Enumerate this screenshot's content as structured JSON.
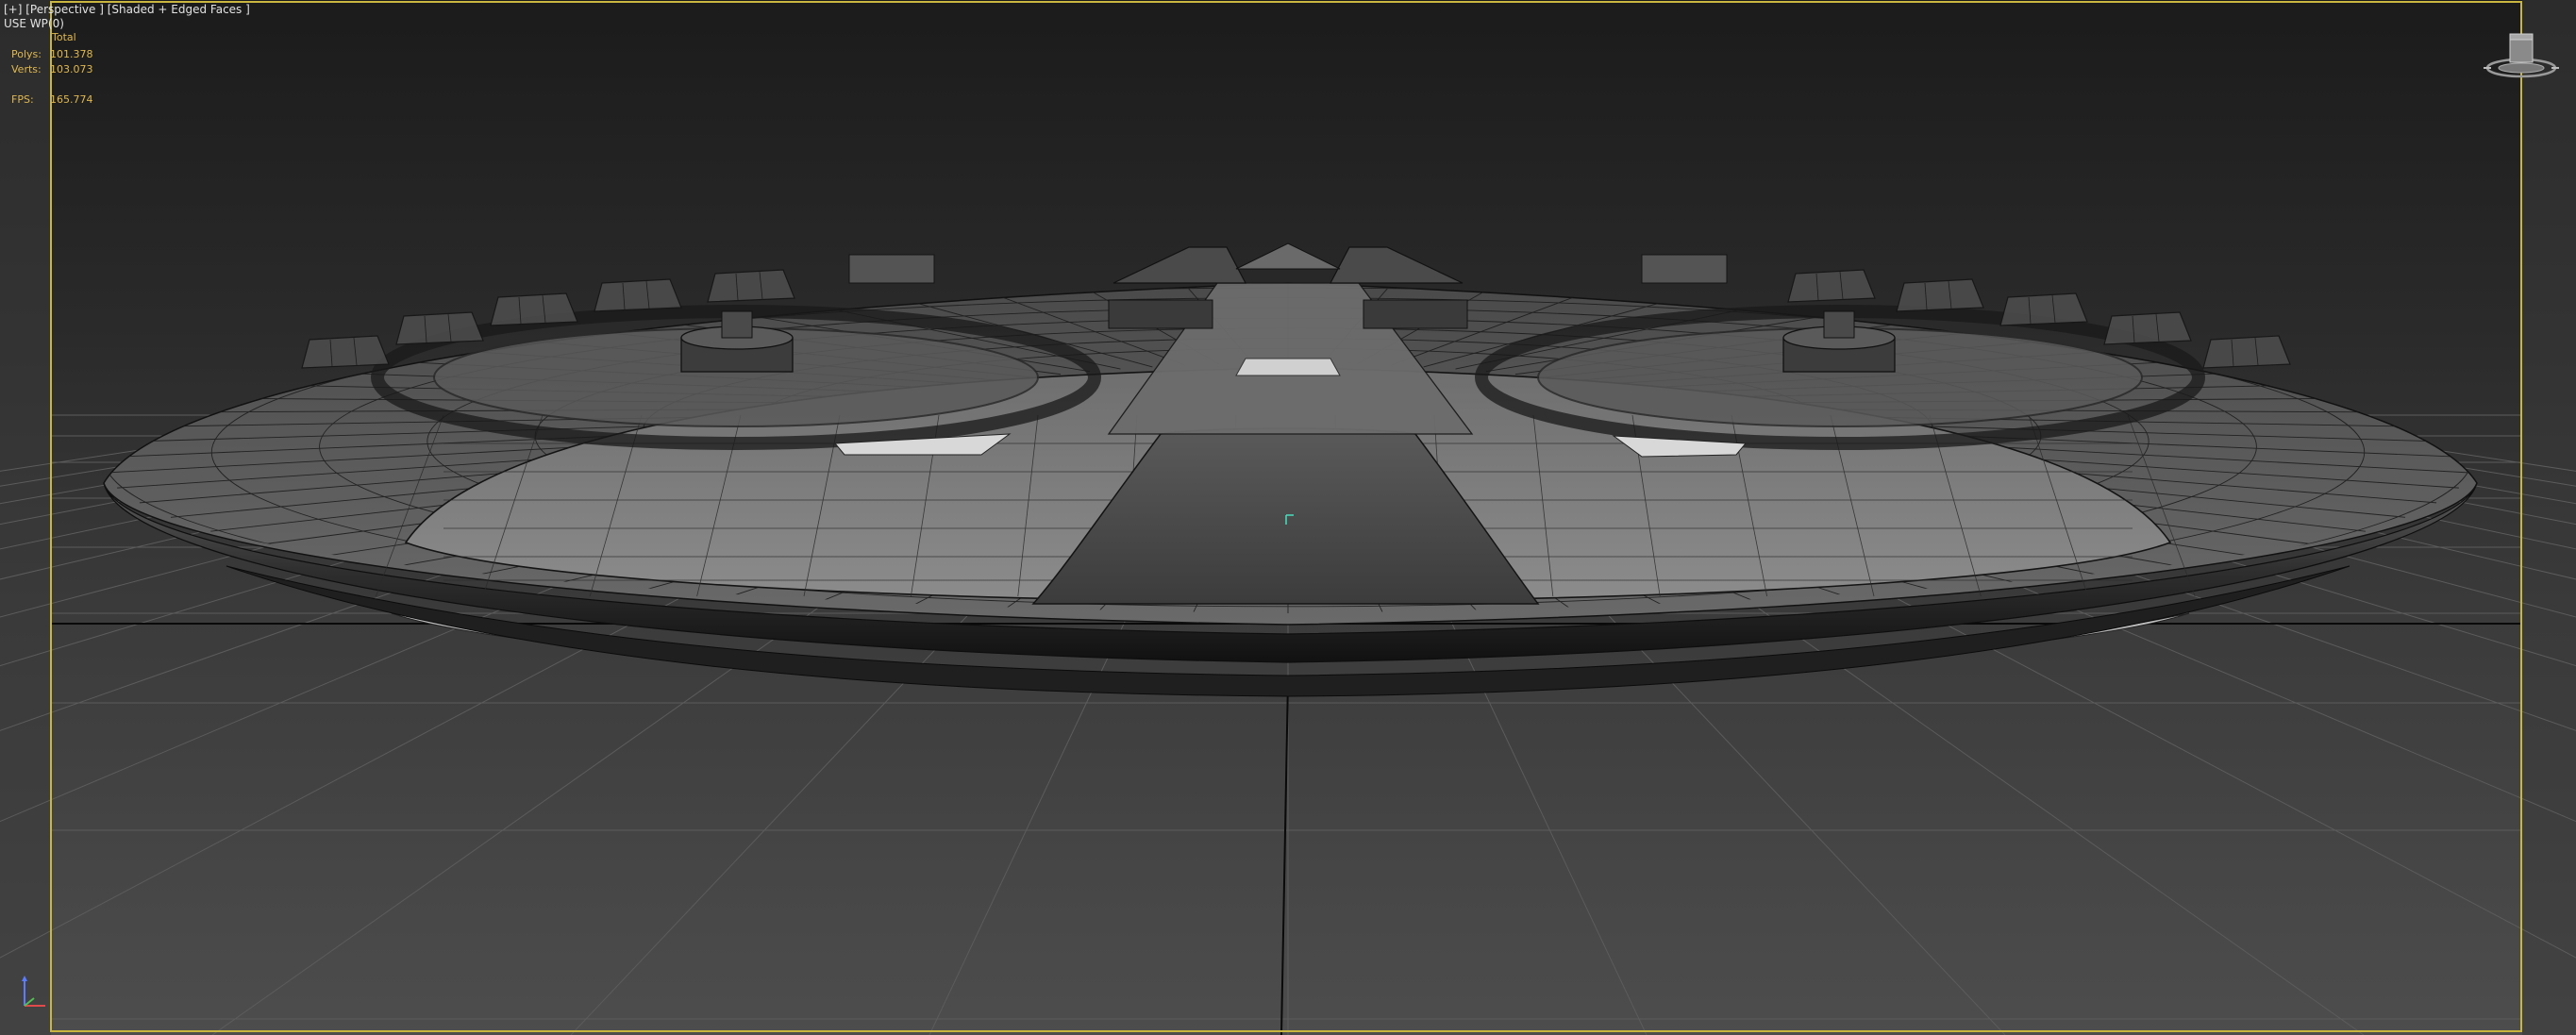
{
  "viewport": {
    "label_line1": "[+] [Perspective ] [Shaded + Edged Faces ]",
    "label_line2": "USE WP(0)"
  },
  "stats": {
    "header": "Total",
    "polys_label": "Polys:",
    "polys_value": "101.378",
    "verts_label": "Verts:",
    "verts_value": "103.073",
    "fps_label": "FPS:",
    "fps_value": "165.774"
  },
  "colors": {
    "background_top": "#1d1d1d",
    "background_bottom": "#4a4a4a",
    "safe_frame": "#c8b640",
    "stats_text": "#e0b850",
    "label_text": "#e2e2e2"
  },
  "icons": {
    "viewcube": "viewcube-icon",
    "axis_tripod": "axis-tripod-icon",
    "pivot": "pivot-marker-icon"
  }
}
